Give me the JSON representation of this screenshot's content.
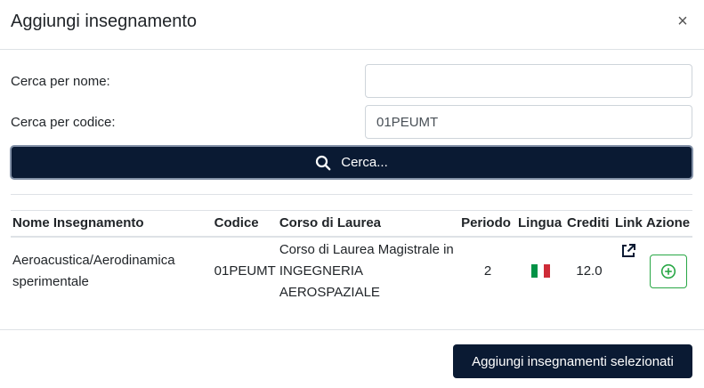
{
  "modal": {
    "title": "Aggiungi insegnamento",
    "close_label": "×"
  },
  "search": {
    "name_label": "Cerca per nome:",
    "name_value": "",
    "code_label": "Cerca per codice:",
    "code_value": "01PEUMT",
    "button_label": "Cerca...",
    "button_icon": "search-icon"
  },
  "table": {
    "headers": [
      "Nome Insegnamento",
      "Codice",
      "Corso di Laurea",
      "Periodo",
      "Lingua",
      "Crediti",
      "Link",
      "Azione"
    ],
    "rows": [
      {
        "name": "Aeroacustica/Aerodinamica sperimentale",
        "code": "01PEUMT",
        "course": "Corso di Laurea Magistrale in INGEGNERIA AEROSPAZIALE",
        "period": "2",
        "language_icon": "italy-flag-icon",
        "credits": "12.0",
        "link_icon": "external-link-icon",
        "action_icon": "add-circle-icon"
      }
    ]
  },
  "footer": {
    "submit_label": "Aggiungi insegnamenti selezionati"
  },
  "colors": {
    "primary_dark": "#0a1a33",
    "add_green": "#28a745",
    "flag_green": "#009246",
    "flag_white": "#ffffff",
    "flag_red": "#ce2b37"
  }
}
